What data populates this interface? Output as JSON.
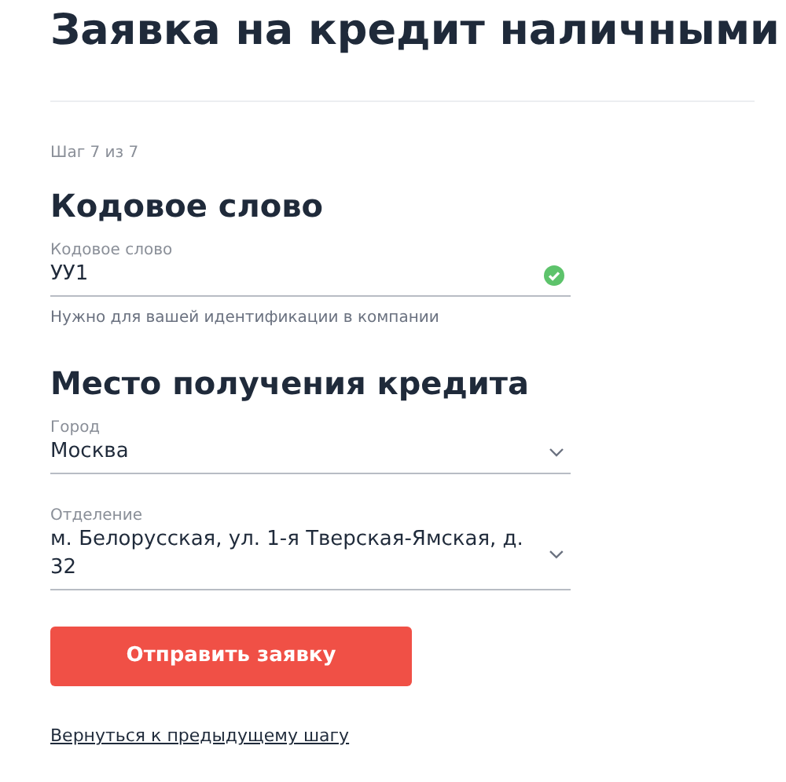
{
  "page_title": "Заявка на кредит наличными",
  "step": "Шаг 7 из 7",
  "sections": [
    {
      "heading": "Кодовое слово",
      "fields": [
        {
          "kind": "text",
          "label": "Кодовое слово",
          "value": "УУ1",
          "valid": true,
          "hint": "Нужно для вашей идентификации в компании"
        }
      ]
    },
    {
      "heading": "Место получения кредита",
      "fields": [
        {
          "kind": "select",
          "label": "Город",
          "value": "Москва"
        },
        {
          "kind": "select",
          "label": "Отделение",
          "value": "м. Белорусская, ул. 1-я Тверская-Ямская, д. 32"
        }
      ]
    }
  ],
  "submit_button": "Отправить заявку",
  "back_link": "Вернуться к предыдущему шагу"
}
